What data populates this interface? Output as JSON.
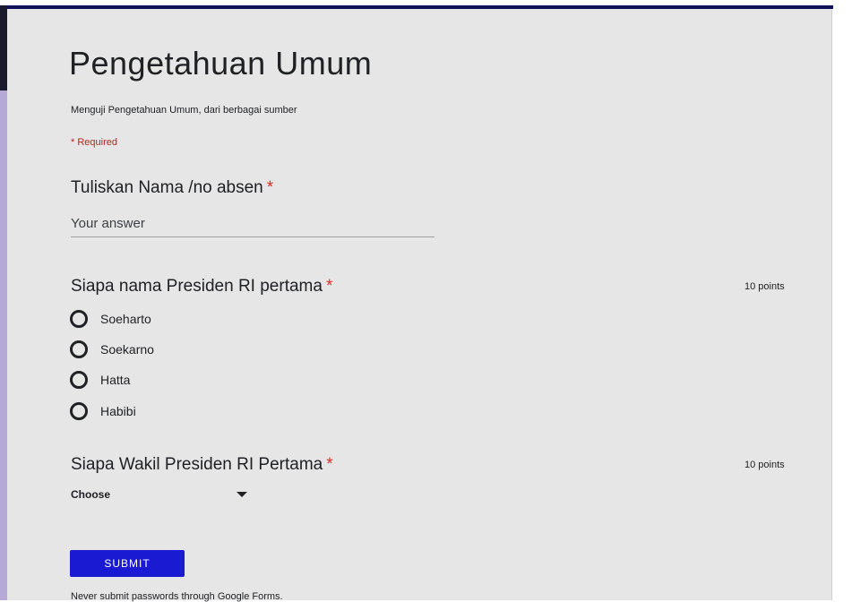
{
  "colors": {
    "card_background": "#e6e6e6",
    "header_bar": "#11115a",
    "left_accent": "#b6a9d6",
    "required": "#d93025",
    "submit_button": "#1a1ad3"
  },
  "form": {
    "title": "Pengetahuan Umum",
    "description": "Menguji Pengetahuan Umum, dari berbagai sumber",
    "required_note": "* Required"
  },
  "questions": [
    {
      "title": "Tuliskan Nama /no absen",
      "required_marker": "*",
      "type": "short-answer",
      "placeholder": "Your answer"
    },
    {
      "title": "Siapa nama Presiden RI pertama",
      "required_marker": "*",
      "points": "10 points",
      "type": "multiple-choice",
      "options": [
        "Soeharto",
        "Soekarno",
        "Hatta",
        "Habibi"
      ]
    },
    {
      "title": "Siapa Wakil Presiden RI Pertama",
      "required_marker": "*",
      "points": "10 points",
      "type": "dropdown",
      "selected": "Choose",
      "icon": "caret-down-icon"
    }
  ],
  "submit_label": "SUBMIT",
  "footer": "Never submit passwords through Google Forms."
}
